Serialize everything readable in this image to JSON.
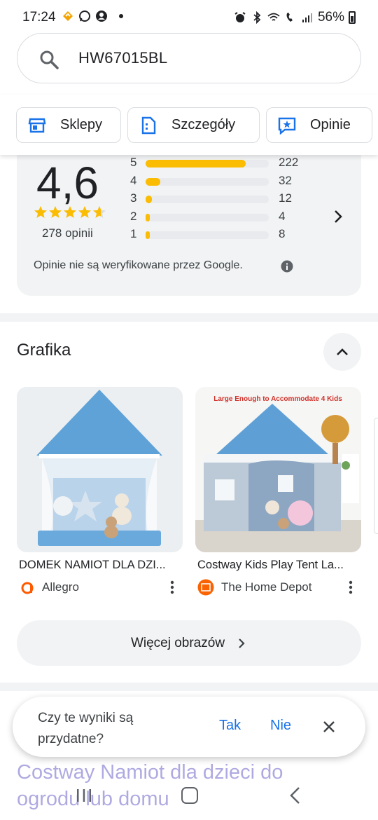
{
  "status_bar": {
    "time": "17:24",
    "battery": "56%"
  },
  "search": {
    "query": "HW67015BL"
  },
  "chips": [
    {
      "label": "Sklepy",
      "icon": "store-icon"
    },
    {
      "label": "Szczegóły",
      "icon": "details-icon"
    },
    {
      "label": "Opinie",
      "icon": "reviews-icon"
    }
  ],
  "ratings": {
    "average": "4,6",
    "star_value": 4.6,
    "count_label": "278 opinii",
    "breakdown": [
      {
        "stars": "5",
        "count": "222",
        "fraction": 0.81
      },
      {
        "stars": "4",
        "count": "32",
        "fraction": 0.12
      },
      {
        "stars": "3",
        "count": "12",
        "fraction": 0.05
      },
      {
        "stars": "2",
        "count": "4",
        "fraction": 0.02
      },
      {
        "stars": "1",
        "count": "8",
        "fraction": 0.03
      }
    ],
    "note": "Opinie nie są weryfikowane przez Google."
  },
  "images_section": {
    "title": "Grafika",
    "items": [
      {
        "title": "DOMEK NAMIOT DLA DZI...",
        "source": "Allegro",
        "source_icon": "allegro-icon",
        "source_color": "#ff5a00"
      },
      {
        "title": "Costway Kids Play Tent La...",
        "source": "The Home Depot",
        "source_icon": "home-depot-icon",
        "source_color": "#f96302",
        "banner": "Large Enough to Accommodate 4 Kids"
      }
    ],
    "more_label": "Więcej obrazów"
  },
  "result_fragment": {
    "line1": "Costway Namiot dla dzieci do",
    "line2": "ogrodu lub domu"
  },
  "feedback": {
    "question": "Czy te wyniki są przydatne?",
    "yes": "Tak",
    "no": "Nie"
  },
  "colors": {
    "star": "#fbbc04",
    "link": "#1a73e8",
    "tent_blue": "#6aa9dc"
  }
}
